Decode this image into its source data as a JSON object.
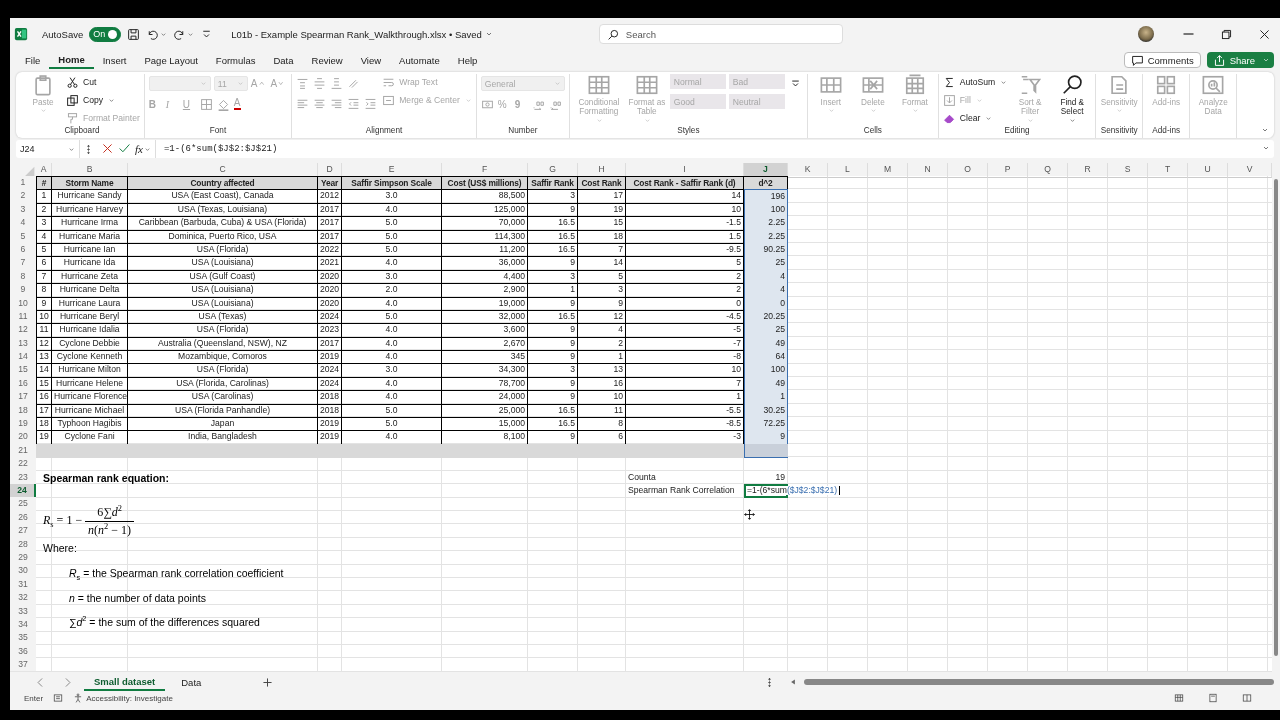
{
  "title_bar": {
    "autosave_label": "AutoSave",
    "autosave": {
      "on": true,
      "text": "On"
    },
    "file_title": "L01b - Example Spearman Rank_Walkthrough.xlsx • Saved",
    "search": {
      "placeholder": "Search"
    }
  },
  "menu_tabs": [
    {
      "label": "File",
      "selected": false
    },
    {
      "label": "Home",
      "selected": true
    },
    {
      "label": "Insert",
      "selected": false
    },
    {
      "label": "Page Layout",
      "selected": false
    },
    {
      "label": "Formulas",
      "selected": false
    },
    {
      "label": "Data",
      "selected": false
    },
    {
      "label": "Review",
      "selected": false
    },
    {
      "label": "View",
      "selected": false
    },
    {
      "label": "Automate",
      "selected": false
    },
    {
      "label": "Help",
      "selected": false
    }
  ],
  "comments_button": "Comments",
  "share_button": "Share",
  "ribbon": [
    {
      "label": "Clipboard",
      "columns": [
        [
          [
            {
              "kind": "paste",
              "label": "Paste",
              "disabled": true
            }
          ]
        ],
        [
          [
            {
              "kind": "cut",
              "label": "Cut",
              "disabled": false
            }
          ],
          [
            {
              "kind": "copy",
              "label": "Copy",
              "disabled": false
            }
          ],
          [
            {
              "kind": "format-painter",
              "label": "Format Painter",
              "disabled": true
            }
          ]
        ]
      ]
    },
    {
      "label": "Font",
      "columns": [
        [
          [
            {
              "kind": "font-name",
              "disabled": true
            },
            {
              "kind": "font-size",
              "label": "11",
              "disabled": true
            },
            {
              "kind": "grow-font",
              "label": "A",
              "disabled": true
            },
            {
              "kind": "shrink-font",
              "label": "A",
              "disabled": true
            }
          ],
          [
            {
              "kind": "bold",
              "label": "B",
              "disabled": true
            },
            {
              "kind": "italic",
              "label": "I",
              "disabled": true
            },
            {
              "kind": "underline",
              "label": "U",
              "disabled": true
            },
            {
              "kind": "borders",
              "disabled": true
            },
            {
              "kind": "fill-color",
              "disabled": true
            },
            {
              "kind": "font-color",
              "label": "A",
              "disabled": true
            }
          ]
        ]
      ]
    },
    {
      "label": "Alignment",
      "columns": [
        [
          [
            {
              "kind": "align-top",
              "disabled": true
            },
            {
              "kind": "align-middle",
              "disabled": true
            },
            {
              "kind": "align-bottom",
              "disabled": true
            },
            {
              "kind": "orientation",
              "disabled": true
            }
          ],
          [
            {
              "kind": "align-left",
              "disabled": true
            },
            {
              "kind": "align-center",
              "disabled": true
            },
            {
              "kind": "align-right",
              "disabled": true
            },
            {
              "kind": "indent-less",
              "disabled": true
            },
            {
              "kind": "indent-more",
              "disabled": true
            }
          ]
        ],
        [
          [
            {
              "kind": "wrap-text",
              "label": "Wrap Text",
              "disabled": true
            }
          ],
          [
            {
              "kind": "merge-center",
              "label": "Merge & Center",
              "disabled": true
            }
          ]
        ]
      ]
    },
    {
      "label": "Number",
      "columns": [
        [
          [
            {
              "kind": "number-format",
              "label": "General",
              "disabled": true
            }
          ],
          [
            {
              "kind": "accounting",
              "disabled": true
            },
            {
              "kind": "percent",
              "label": "%",
              "disabled": true
            },
            {
              "kind": "comma",
              "label": "9",
              "disabled": true
            },
            {
              "kind": "decimals-more",
              "disabled": true
            },
            {
              "kind": "decimals-less",
              "disabled": true
            }
          ]
        ]
      ]
    },
    {
      "label": "Styles",
      "columns": [
        [
          [
            {
              "kind": "conditional-formatting",
              "label": "Conditional Formatting",
              "disabled": true
            }
          ]
        ],
        [
          [
            {
              "kind": "format-as-table",
              "label": "Format as Table",
              "disabled": true
            }
          ]
        ],
        [
          [
            {
              "kind": "style",
              "label": "Normal",
              "disabled": true
            },
            {
              "kind": "style",
              "label": "Bad",
              "disabled": true
            }
          ],
          [
            {
              "kind": "style",
              "label": "Good",
              "disabled": true
            },
            {
              "kind": "style",
              "label": "Neutral",
              "disabled": true
            }
          ]
        ],
        [
          [
            {
              "kind": "gallery-more",
              "disabled": false
            }
          ]
        ]
      ]
    },
    {
      "label": "Cells",
      "columns": [
        [
          [
            {
              "kind": "insert",
              "label": "Insert",
              "disabled": true
            }
          ]
        ],
        [
          [
            {
              "kind": "delete",
              "label": "Delete",
              "disabled": true
            }
          ]
        ],
        [
          [
            {
              "kind": "format",
              "label": "Format",
              "disabled": true
            }
          ]
        ]
      ]
    },
    {
      "label": "Editing",
      "columns": [
        [
          [
            {
              "kind": "autosum",
              "label": "AutoSum",
              "disabled": false
            }
          ],
          [
            {
              "kind": "fill",
              "label": "Fill",
              "disabled": true
            }
          ],
          [
            {
              "kind": "clear",
              "label": "Clear",
              "disabled": false
            }
          ]
        ],
        [
          [
            {
              "kind": "sort-filter",
              "label": "Sort & Filter",
              "disabled": true
            }
          ]
        ],
        [
          [
            {
              "kind": "find-select",
              "label": "Find & Select",
              "disabled": false
            }
          ]
        ]
      ]
    },
    {
      "label": "Sensitivity",
      "columns": [
        [
          [
            {
              "kind": "sensitivity",
              "label": "Sensitivity",
              "disabled": true
            }
          ]
        ]
      ]
    },
    {
      "label": "Add-ins",
      "columns": [
        [
          [
            {
              "kind": "add-ins",
              "label": "Add-ins",
              "disabled": true
            }
          ]
        ]
      ]
    },
    {
      "columns": [
        [
          [
            {
              "kind": "analyze-data",
              "label": "Analyze Data",
              "disabled": true
            }
          ]
        ]
      ]
    }
  ],
  "formula_bar": {
    "name_box": "J24",
    "fx": "fx",
    "formula": "=1-(6*sum($J$2:$J$21)"
  },
  "column_headers": [
    {
      "label": "A",
      "selected": false
    },
    {
      "label": "B",
      "selected": false
    },
    {
      "label": "C",
      "selected": false
    },
    {
      "label": "D",
      "selected": false
    },
    {
      "label": "E",
      "selected": false
    },
    {
      "label": "F",
      "selected": false
    },
    {
      "label": "G",
      "selected": false
    },
    {
      "label": "H",
      "selected": false
    },
    {
      "label": "I",
      "selected": false
    },
    {
      "label": "J",
      "selected": true
    },
    {
      "label": "K",
      "selected": false
    },
    {
      "label": "L",
      "selected": false
    },
    {
      "label": "M",
      "selected": false
    },
    {
      "label": "N",
      "selected": false
    },
    {
      "label": "O",
      "selected": false
    },
    {
      "label": "P",
      "selected": false
    },
    {
      "label": "Q",
      "selected": false
    },
    {
      "label": "R",
      "selected": false
    },
    {
      "label": "S",
      "selected": false
    },
    {
      "label": "T",
      "selected": false
    },
    {
      "label": "U",
      "selected": false
    },
    {
      "label": "V",
      "selected": false
    }
  ],
  "row_headers": [
    {
      "label": "1",
      "selected": false
    },
    {
      "label": "2",
      "selected": false
    },
    {
      "label": "3",
      "selected": false
    },
    {
      "label": "4",
      "selected": false
    },
    {
      "label": "5",
      "selected": false
    },
    {
      "label": "6",
      "selected": false
    },
    {
      "label": "7",
      "selected": false
    },
    {
      "label": "8",
      "selected": false
    },
    {
      "label": "9",
      "selected": false
    },
    {
      "label": "10",
      "selected": false
    },
    {
      "label": "11",
      "selected": false
    },
    {
      "label": "12",
      "selected": false
    },
    {
      "label": "13",
      "selected": false
    },
    {
      "label": "14",
      "selected": false
    },
    {
      "label": "15",
      "selected": false
    },
    {
      "label": "16",
      "selected": false
    },
    {
      "label": "17",
      "selected": false
    },
    {
      "label": "18",
      "selected": false
    },
    {
      "label": "19",
      "selected": false
    },
    {
      "label": "20",
      "selected": false
    },
    {
      "label": "21",
      "selected": false
    },
    {
      "label": "22",
      "selected": false
    },
    {
      "label": "23",
      "selected": false
    },
    {
      "label": "24",
      "selected": true
    },
    {
      "label": "25",
      "selected": false
    },
    {
      "label": "26",
      "selected": false
    },
    {
      "label": "27",
      "selected": false
    },
    {
      "label": "28",
      "selected": false
    },
    {
      "label": "29",
      "selected": false
    },
    {
      "label": "30",
      "selected": false
    },
    {
      "label": "31",
      "selected": false
    },
    {
      "label": "32",
      "selected": false
    },
    {
      "label": "33",
      "selected": false
    },
    {
      "label": "34",
      "selected": false
    },
    {
      "label": "35",
      "selected": false
    },
    {
      "label": "36",
      "selected": false
    },
    {
      "label": "37",
      "selected": false
    }
  ],
  "table": {
    "columns": [
      "#",
      "Storm Name",
      "Country affected",
      "Year",
      "Saffir Simpson Scale",
      "Cost (US$ millions)",
      "Saffir Rank",
      "Cost Rank",
      "Cost Rank - Saffir Rank (d)",
      "d^2"
    ],
    "rows": [
      [
        "1",
        "Hurricane Sandy",
        "USA (East Coast), Canada",
        "2012",
        "3.0",
        "88,500",
        "3",
        "17",
        "14",
        "196"
      ],
      [
        "2",
        "Hurricane Harvey",
        "USA (Texas, Louisiana)",
        "2017",
        "4.0",
        "125,000",
        "9",
        "19",
        "10",
        "100"
      ],
      [
        "3",
        "Hurricane Irma",
        "Caribbean (Barbuda, Cuba) & USA (Florida)",
        "2017",
        "5.0",
        "70,000",
        "16.5",
        "15",
        "-1.5",
        "2.25"
      ],
      [
        "4",
        "Hurricane Maria",
        "Dominica, Puerto Rico, USA",
        "2017",
        "5.0",
        "114,300",
        "16.5",
        "18",
        "1.5",
        "2.25"
      ],
      [
        "5",
        "Hurricane Ian",
        "USA (Florida)",
        "2022",
        "5.0",
        "11,200",
        "16.5",
        "7",
        "-9.5",
        "90.25"
      ],
      [
        "6",
        "Hurricane Ida",
        "USA (Louisiana)",
        "2021",
        "4.0",
        "36,000",
        "9",
        "14",
        "5",
        "25"
      ],
      [
        "7",
        "Hurricane Zeta",
        "USA (Gulf Coast)",
        "2020",
        "3.0",
        "4,400",
        "3",
        "5",
        "2",
        "4"
      ],
      [
        "8",
        "Hurricane Delta",
        "USA (Louisiana)",
        "2020",
        "2.0",
        "2,900",
        "1",
        "3",
        "2",
        "4"
      ],
      [
        "9",
        "Hurricane Laura",
        "USA (Louisiana)",
        "2020",
        "4.0",
        "19,000",
        "9",
        "9",
        "0",
        "0"
      ],
      [
        "10",
        "Hurricane Beryl",
        "USA (Texas)",
        "2024",
        "5.0",
        "32,000",
        "16.5",
        "12",
        "-4.5",
        "20.25"
      ],
      [
        "11",
        "Hurricane Idalia",
        "USA (Florida)",
        "2023",
        "4.0",
        "3,600",
        "9",
        "4",
        "-5",
        "25"
      ],
      [
        "12",
        "Cyclone Debbie",
        "Australia (Queensland, NSW), NZ",
        "2017",
        "4.0",
        "2,670",
        "9",
        "2",
        "-7",
        "49"
      ],
      [
        "13",
        "Cyclone Kenneth",
        "Mozambique, Comoros",
        "2019",
        "4.0",
        "345",
        "9",
        "1",
        "-8",
        "64"
      ],
      [
        "14",
        "Hurricane Milton",
        "USA (Florida)",
        "2024",
        "3.0",
        "34,300",
        "3",
        "13",
        "10",
        "100"
      ],
      [
        "15",
        "Hurricane Helene",
        "USA (Florida, Carolinas)",
        "2024",
        "4.0",
        "78,700",
        "9",
        "16",
        "7",
        "49"
      ],
      [
        "16",
        "Hurricane Florence",
        "USA (Carolinas)",
        "2018",
        "4.0",
        "24,000",
        "9",
        "10",
        "1",
        "1"
      ],
      [
        "17",
        "Hurricane Michael",
        "USA (Florida Panhandle)",
        "2018",
        "5.0",
        "25,000",
        "16.5",
        "11",
        "-5.5",
        "30.25"
      ],
      [
        "18",
        "Typhoon Hagibis",
        "Japan",
        "2019",
        "5.0",
        "15,000",
        "16.5",
        "8",
        "-8.5",
        "72.25"
      ],
      [
        "19",
        "Cyclone Fani",
        "India, Bangladesh",
        "2019",
        "4.0",
        "8,100",
        "9",
        "6",
        "-3",
        "9"
      ]
    ]
  },
  "calc_cells": {
    "counta_label": "Counta",
    "counta_value": "19",
    "correlation_label": "Spearman Rank Correlation",
    "formula_text": "=1-(6*sum",
    "formula_reference": "($J$2:$J$21)"
  },
  "notes": {
    "heading": "Spearman rank equation:",
    "equation_lhs": "*R*$_{s}$ = 1 −",
    "numerator": "6∑*d*$^{2}$",
    "denominator": "*n*(*n*$^{2}$ − 1)",
    "where": "Where:",
    "definitions": [
      "*R*$_{s}$ = the Spearman rank correlation coefficient",
      "*n* = the number of data points",
      "∑*d*$^{2}$ = the sum of the differences squared"
    ]
  },
  "sheet_tabs": [
    {
      "label": "Small dataset",
      "selected": true
    },
    {
      "label": "Data",
      "selected": false
    }
  ],
  "status_bar": {
    "mode": "Enter",
    "accessibility": "Accessibility: Investigate"
  }
}
